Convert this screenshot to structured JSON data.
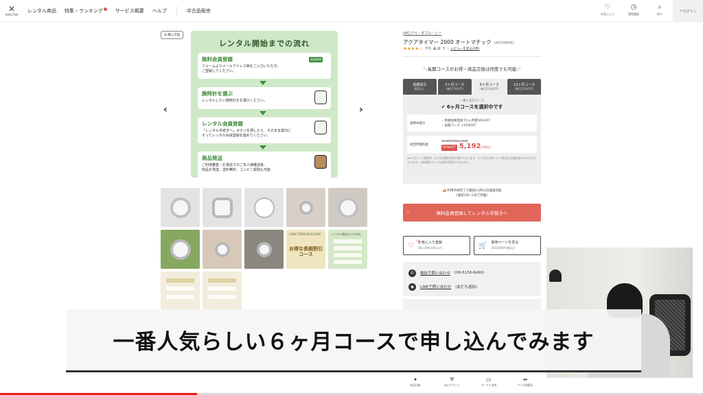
{
  "header": {
    "logo_text": "RAKUTEN",
    "nav": [
      "レンタル商品",
      "特集・ランキング",
      "サービス概要",
      "ヘルプ",
      "中古品販売"
    ],
    "icons": [
      {
        "icon": "heart-icon",
        "label": "お気に入り"
      },
      {
        "icon": "history-icon",
        "label": "閲覧履歴"
      },
      {
        "icon": "search-icon",
        "label": "探す"
      }
    ],
    "login": "ログイン"
  },
  "gallery": {
    "purchase_badge": "購入可能",
    "flow": {
      "title": "レンタル開始までの流れ",
      "member_tag": "会員登録",
      "steps": [
        {
          "title": "無料会員登録",
          "desc1": "フォームよりメールアドレス等をご入力いただき、",
          "desc2": "ご登録してください。"
        },
        {
          "title": "腕時計を選ぶ",
          "desc1": "レンタルしたい腕時計をお選びください。",
          "desc2": ""
        },
        {
          "title": "レンタル会員登録",
          "desc1": "「レンタル手続きへ」ボタンを押したら、そのまま案内に",
          "desc2": "そってレンタル会員登録を進めてください。"
        },
        {
          "title": "商品発送",
          "desc1": "ご利用審査・お電話でのご本人様確認後、",
          "desc2": "商品を発送。送料無料、コンビニ受取も可能"
        }
      ]
    },
    "thumb_labels": {
      "t9_small": "LONG TERM DISCOUNT",
      "t9": "お得な長期割引コース",
      "t10_small": "レンタル開始までの流れ"
    }
  },
  "product": {
    "brand": "IWC/アイ・ダブル・シー",
    "name": "アクアタイマー 2000 オートマチック",
    "code": "(IW356806)",
    "stars": "★★★★☆",
    "avg_label": "平均",
    "avg": "4.0",
    "avg_unit": "点",
    "review_link": "レビューを見る(3件)"
  },
  "promo": "＼長期コースがお得・商品交換は何度でも可能／",
  "tabs": [
    {
      "label": "長期割引",
      "sub": "適用なし"
    },
    {
      "label": "3ヶ月コース",
      "sub": "(毎月7%OFF)"
    },
    {
      "label": "6ヶ月コース",
      "sub": "(毎月10%OFF)"
    },
    {
      "label": "12ヶ月コース",
      "sub": "(毎月12%OFF)"
    }
  ],
  "course": {
    "popular": "一番人気のコース",
    "selected": "6ヶ月コースを選択中です",
    "discount_label": "適用中割引",
    "discount_1": "・新規会員登録で2ヶ月間50%OFF",
    "discount_2": "・長期コース +10%OFF",
    "first_fee_label": "初回月額料金",
    "orig_price": "12,980円(税込)/月額",
    "off_badge": "60%OFF",
    "price": "5,192",
    "price_unit": "円(税込)",
    "note": "※6ヶ月コース選択時、6ヶ月の継続利用が条件となります。2ヶ月目以降のコース料金は月額料金の10%引きとなります。※長期割引コースは途中変更ができません。"
  },
  "delivery": {
    "line1": "利用手続完了で最短11月01日発送可能",
    "line2": "(通常1日〜2日で到着)"
  },
  "cta": "無料会員登録してレンタル手続きへ",
  "buttons": {
    "favorite_label": "お気に入り登録",
    "favorite_sub": "(再入荷をお知らせ)",
    "favorite_count": "34",
    "buy_label": "販売ページを見る",
    "buy_sub": "(426,800円(税込))"
  },
  "contact": {
    "phone": "電話で問い合わせ",
    "phone_num": "(06-6136-6490)",
    "line": "LINEで問い合わせ",
    "line_sub": "(友だち追加)"
  },
  "caption": "一番人気らしい６ヶ月コースで申し込んでみます",
  "toolbar": [
    "商品比較",
    "安心サポート",
    "カードで決済",
    "サイズ調整可"
  ],
  "video_progress": 0.28,
  "colors": {
    "accent": "#e06659",
    "green": "#3e8a3a",
    "flow_bg": "#cfe8c8"
  }
}
